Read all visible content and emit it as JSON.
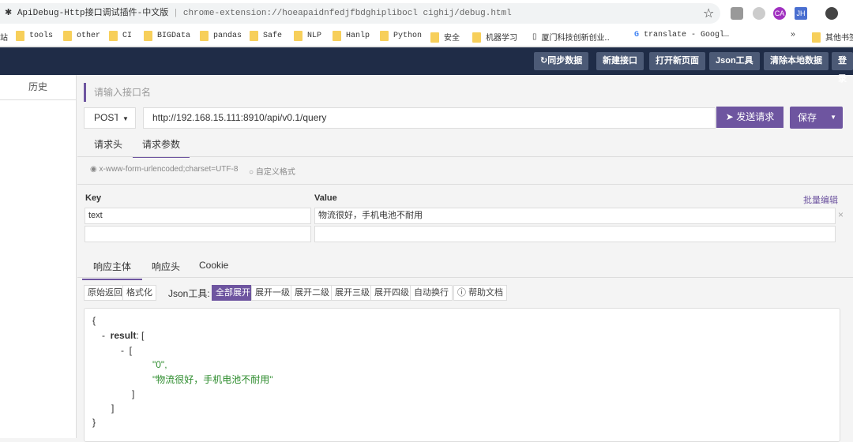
{
  "browser": {
    "tab_title": "ApiDebug-Http接口调试插件-中文版",
    "url": "chrome-extension://hoeapaidnfedjfbdghiplibocl cighij/debug.html",
    "bookmarks": [
      "tools",
      "other",
      "CI",
      "BIGData",
      "pandas",
      "Safe",
      "NLP",
      "Hanlp",
      "Python",
      "安全",
      "机器学习",
      "厦门科技创新创业…",
      "translate - Googl…"
    ],
    "more": "»",
    "other_bookmarks": "其他书签",
    "ext_ca": "CA",
    "ext_jh": "JH",
    "bm_left": "站"
  },
  "nav": {
    "sync": "同步数据",
    "new": "新建接口",
    "open": "打开新页面",
    "json": "Json工具",
    "clear": "清除本地数据",
    "login": "登录"
  },
  "sidebar": {
    "history": "历史"
  },
  "request": {
    "name_placeholder": "请输入接口名",
    "method": "POST",
    "url": "http://192.168.15.111:8910/api/v0.1/query",
    "send": "发送请求",
    "save": "保存",
    "tabs": [
      "请求头",
      "请求参数"
    ],
    "format1": "x-www-form-urlencoded;charset=UTF-8",
    "format2": "自定义格式",
    "key_header": "Key",
    "value_header": "Value",
    "bulk_edit": "批量编辑",
    "params": [
      {
        "key": "text",
        "value": "物流很好，手机电池不耐用"
      }
    ]
  },
  "response": {
    "tabs": [
      "响应主体",
      "响应头",
      "Cookie"
    ],
    "raw": "原始返回",
    "format": "格式化",
    "json_tool_label": "Json工具:",
    "expand_buttons": [
      "全部展开",
      "展开一级",
      "展开二级",
      "展开三级",
      "展开四级",
      "自动换行"
    ],
    "help": "帮助文档",
    "json": {
      "open": "{",
      "minus": "-",
      "key": "result",
      "colon": ": [",
      "inner_open": "[",
      "v1": "\"0\",",
      "v2": "\"物流很好，手机电池不耐用\"",
      "inner_close": "]",
      "outer_close": "]",
      "close": "}"
    }
  }
}
